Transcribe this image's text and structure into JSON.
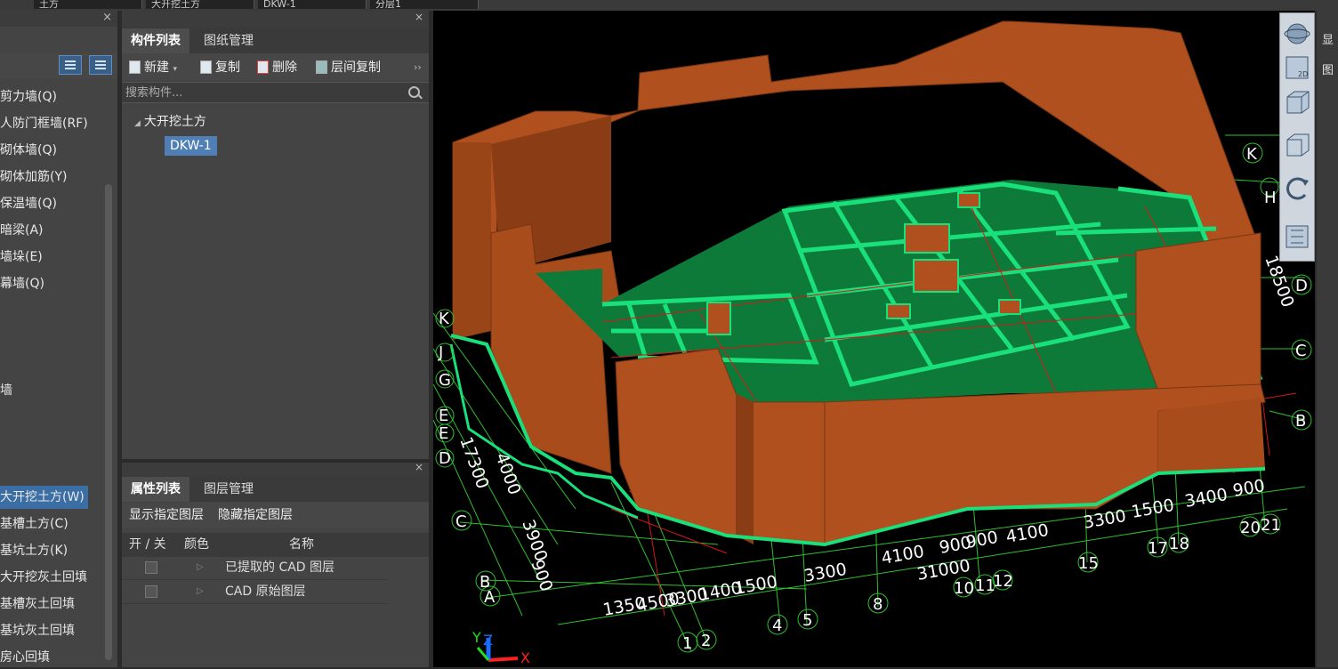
{
  "top_tabs": [
    "土方",
    "大开挖土方",
    "DKW-1",
    "分层1"
  ],
  "left_tree": {
    "items": [
      "剪力墙(Q)",
      "人防门框墙(RF)",
      "砌体墙(Q)",
      "砌体加筋(Y)",
      "保温墙(Q)",
      "暗梁(A)",
      "墙垛(E)",
      "幕墙(Q)",
      "墙",
      "大开挖土方(W)",
      "基槽土方(C)",
      "基坑土方(K)",
      "大开挖灰土回填",
      "基槽灰土回填",
      "基坑灰土回填",
      "房心回填"
    ],
    "selected_index": 9
  },
  "component_panel": {
    "tabs": [
      "构件列表",
      "图纸管理"
    ],
    "toolbar": {
      "new": "新建",
      "copy": "复制",
      "delete": "删除",
      "floor_copy": "层间复制",
      "more": "››"
    },
    "search_placeholder": "搜索构件...",
    "tree_root": "大开挖土方",
    "tree_child": "DKW-1"
  },
  "property_panel": {
    "tabs": [
      "属性列表",
      "图层管理"
    ],
    "show_layer": "显示指定图层",
    "hide_layer": "隐藏指定图层",
    "columns": [
      "开 / 关",
      "颜色",
      "名称"
    ],
    "rows": [
      {
        "name": "已提取的 CAD 图层"
      },
      {
        "name": "CAD 原始图层"
      }
    ]
  },
  "viewport": {
    "axis_letters_left": [
      "K",
      "J",
      "G",
      "E",
      "E",
      "D",
      "C",
      "B",
      "A"
    ],
    "axis_letters_right": [
      "K",
      "H",
      "D",
      "C",
      "B"
    ],
    "axis_numbers_bottom": [
      "1",
      "2",
      "4",
      "5",
      "8",
      "10",
      "11",
      "12",
      "15",
      "17",
      "18",
      "20",
      "21"
    ],
    "dim_bottom": [
      "1350",
      "4500",
      "3300",
      "1400",
      "1500",
      "3300",
      "4100",
      "900",
      "900",
      "4100",
      "3300",
      "1500",
      "3400",
      "900",
      "31000"
    ],
    "dim_left": [
      "17300",
      "4000",
      "3900",
      "900"
    ],
    "dim_right": [
      "18500"
    ],
    "axis_x": "X",
    "axis_y": "Y",
    "axis_z": "Z",
    "colors": {
      "earth": "#b0501e",
      "earth_dark": "#7a3512",
      "pit_floor": "#0d7a3a",
      "wall_edge": "#19e07a",
      "grid": "#2fbf2f",
      "red_grid": "#d21818"
    }
  },
  "view_tools": [
    "orbit-icon",
    "2d-view-icon",
    "3d-view-icon",
    "box-view-icon",
    "rotate-icon",
    "layer-grid-icon"
  ],
  "view_tools_label_2d": "2D",
  "right_panel": {
    "label1": "显",
    "label2": "图"
  }
}
